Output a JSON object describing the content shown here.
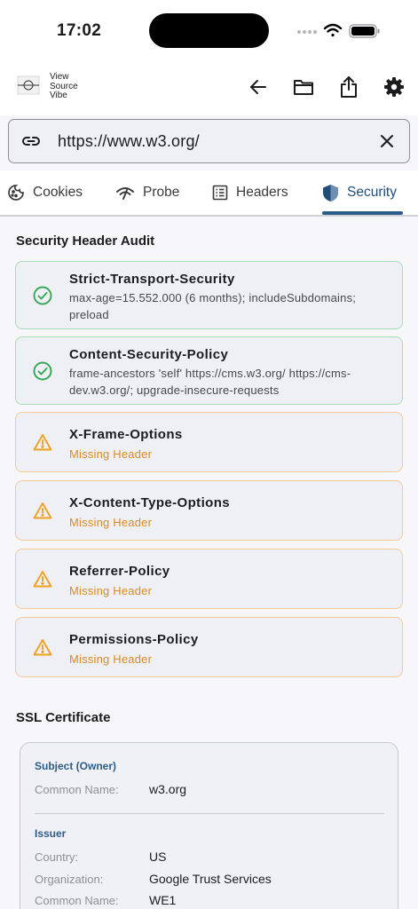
{
  "status_bar": {
    "time": "17:02"
  },
  "app": {
    "logo_lines": [
      "View",
      "Source",
      "Vibe"
    ]
  },
  "header_icons": [
    "back-arrow-icon",
    "folder-icon",
    "share-icon",
    "gear-icon"
  ],
  "url_bar": {
    "value": "https://www.w3.org/"
  },
  "tabs": [
    {
      "label": "Cookies",
      "icon": "cookie-icon",
      "active": false
    },
    {
      "label": "Probe",
      "icon": "probe-icon",
      "active": false
    },
    {
      "label": "Headers",
      "icon": "list-icon",
      "active": false
    },
    {
      "label": "Security",
      "icon": "shield-icon",
      "active": true
    }
  ],
  "audit": {
    "title": "Security Header Audit",
    "items": [
      {
        "name": "Strict-Transport-Security",
        "status": "ok",
        "value_lines": [
          "max-age=15.552.000 (6 months); includeSubdomains;",
          "preload"
        ]
      },
      {
        "name": "Content-Security-Policy",
        "status": "ok",
        "value_lines": [
          "frame-ancestors 'self' https://cms.w3.org/ https://cms-",
          "dev.w3.org/; upgrade-insecure-requests"
        ]
      },
      {
        "name": "X-Frame-Options",
        "status": "missing",
        "missing_label": "Missing Header"
      },
      {
        "name": "X-Content-Type-Options",
        "status": "missing",
        "missing_label": "Missing Header"
      },
      {
        "name": "Referrer-Policy",
        "status": "missing",
        "missing_label": "Missing Header"
      },
      {
        "name": "Permissions-Policy",
        "status": "missing",
        "missing_label": "Missing Header"
      }
    ]
  },
  "ssl": {
    "title": "SSL Certificate",
    "subject": {
      "heading": "Subject (Owner)",
      "common_name_label": "Common Name:",
      "common_name": "w3.org"
    },
    "issuer": {
      "heading": "Issuer",
      "country_label": "Country:",
      "country": "US",
      "organization_label": "Organization:",
      "organization": "Google Trust Services",
      "common_name_label": "Common Name:",
      "common_name": "WE1"
    }
  },
  "colors": {
    "accent": "#2c5d8a",
    "ok": "#34a853",
    "warn": "#f0a020",
    "missing_text": "#e08a1e"
  }
}
